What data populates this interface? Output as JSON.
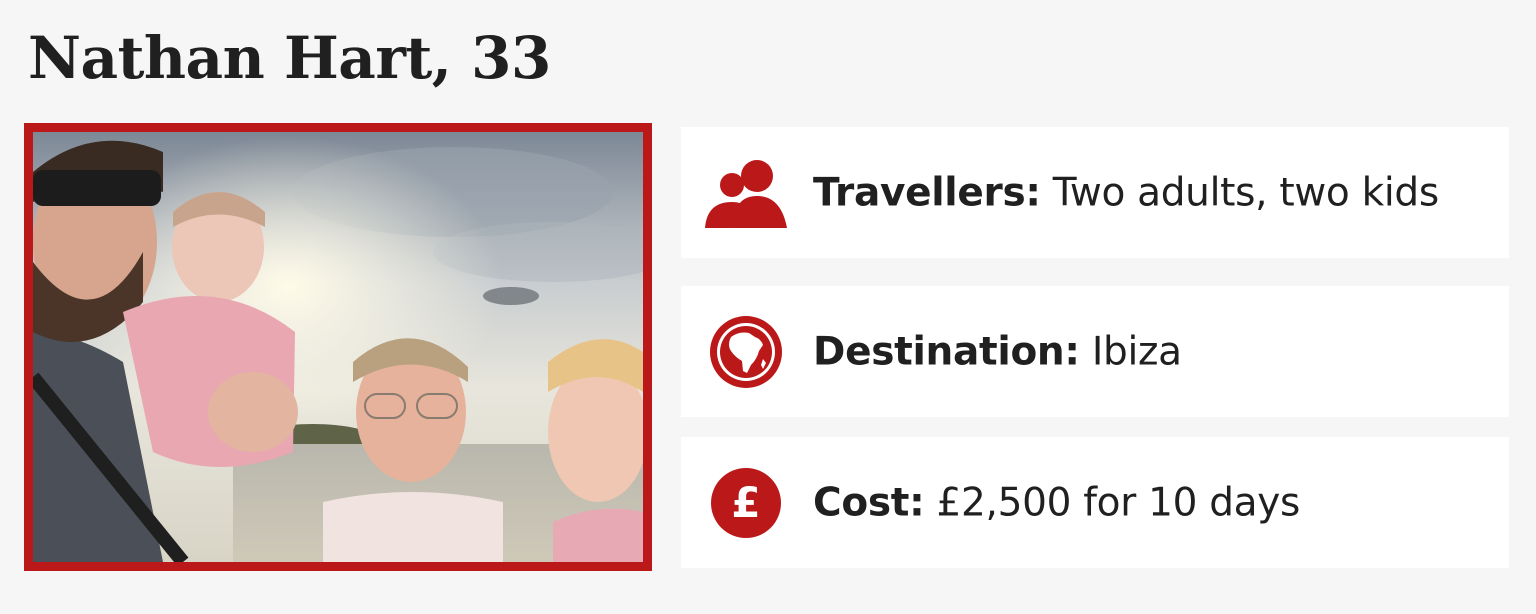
{
  "header": {
    "title": "Nathan Hart, 33"
  },
  "colors": {
    "accent": "#bb1919",
    "background": "#f6f6f6",
    "card": "#ffffff",
    "text": "#202020"
  },
  "photo": {
    "alt": "Family photo on a beach at sunset"
  },
  "facts": [
    {
      "icon": "people-icon",
      "label": "Travellers:",
      "value": "Two adults, two kids"
    },
    {
      "icon": "globe-icon",
      "label": "Destination:",
      "value": "Ibiza"
    },
    {
      "icon": "pound-icon",
      "label": "Cost:",
      "value": "£2,500 for 10 days"
    }
  ]
}
